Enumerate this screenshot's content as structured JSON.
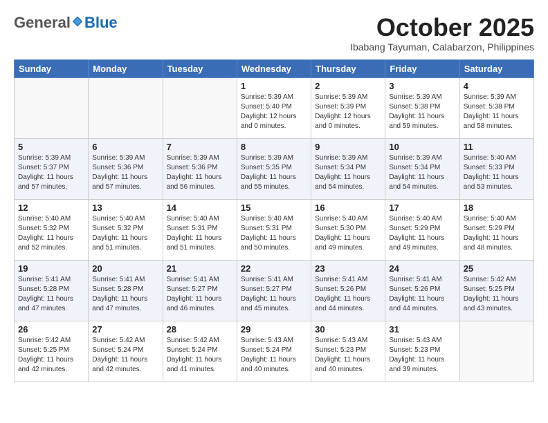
{
  "logo": {
    "general": "General",
    "blue": "Blue"
  },
  "title": "October 2025",
  "subtitle": "Ibabang Tayuman, Calabarzon, Philippines",
  "days_of_week": [
    "Sunday",
    "Monday",
    "Tuesday",
    "Wednesday",
    "Thursday",
    "Friday",
    "Saturday"
  ],
  "weeks": [
    [
      {
        "day": "",
        "info": ""
      },
      {
        "day": "",
        "info": ""
      },
      {
        "day": "",
        "info": ""
      },
      {
        "day": "1",
        "info": "Sunrise: 5:39 AM\nSunset: 5:40 PM\nDaylight: 12 hours\nand 0 minutes."
      },
      {
        "day": "2",
        "info": "Sunrise: 5:39 AM\nSunset: 5:39 PM\nDaylight: 12 hours\nand 0 minutes."
      },
      {
        "day": "3",
        "info": "Sunrise: 5:39 AM\nSunset: 5:38 PM\nDaylight: 11 hours\nand 59 minutes."
      },
      {
        "day": "4",
        "info": "Sunrise: 5:39 AM\nSunset: 5:38 PM\nDaylight: 11 hours\nand 58 minutes."
      }
    ],
    [
      {
        "day": "5",
        "info": "Sunrise: 5:39 AM\nSunset: 5:37 PM\nDaylight: 11 hours\nand 57 minutes."
      },
      {
        "day": "6",
        "info": "Sunrise: 5:39 AM\nSunset: 5:36 PM\nDaylight: 11 hours\nand 57 minutes."
      },
      {
        "day": "7",
        "info": "Sunrise: 5:39 AM\nSunset: 5:36 PM\nDaylight: 11 hours\nand 56 minutes."
      },
      {
        "day": "8",
        "info": "Sunrise: 5:39 AM\nSunset: 5:35 PM\nDaylight: 11 hours\nand 55 minutes."
      },
      {
        "day": "9",
        "info": "Sunrise: 5:39 AM\nSunset: 5:34 PM\nDaylight: 11 hours\nand 54 minutes."
      },
      {
        "day": "10",
        "info": "Sunrise: 5:39 AM\nSunset: 5:34 PM\nDaylight: 11 hours\nand 54 minutes."
      },
      {
        "day": "11",
        "info": "Sunrise: 5:40 AM\nSunset: 5:33 PM\nDaylight: 11 hours\nand 53 minutes."
      }
    ],
    [
      {
        "day": "12",
        "info": "Sunrise: 5:40 AM\nSunset: 5:32 PM\nDaylight: 11 hours\nand 52 minutes."
      },
      {
        "day": "13",
        "info": "Sunrise: 5:40 AM\nSunset: 5:32 PM\nDaylight: 11 hours\nand 51 minutes."
      },
      {
        "day": "14",
        "info": "Sunrise: 5:40 AM\nSunset: 5:31 PM\nDaylight: 11 hours\nand 51 minutes."
      },
      {
        "day": "15",
        "info": "Sunrise: 5:40 AM\nSunset: 5:31 PM\nDaylight: 11 hours\nand 50 minutes."
      },
      {
        "day": "16",
        "info": "Sunrise: 5:40 AM\nSunset: 5:30 PM\nDaylight: 11 hours\nand 49 minutes."
      },
      {
        "day": "17",
        "info": "Sunrise: 5:40 AM\nSunset: 5:29 PM\nDaylight: 11 hours\nand 49 minutes."
      },
      {
        "day": "18",
        "info": "Sunrise: 5:40 AM\nSunset: 5:29 PM\nDaylight: 11 hours\nand 48 minutes."
      }
    ],
    [
      {
        "day": "19",
        "info": "Sunrise: 5:41 AM\nSunset: 5:28 PM\nDaylight: 11 hours\nand 47 minutes."
      },
      {
        "day": "20",
        "info": "Sunrise: 5:41 AM\nSunset: 5:28 PM\nDaylight: 11 hours\nand 47 minutes."
      },
      {
        "day": "21",
        "info": "Sunrise: 5:41 AM\nSunset: 5:27 PM\nDaylight: 11 hours\nand 46 minutes."
      },
      {
        "day": "22",
        "info": "Sunrise: 5:41 AM\nSunset: 5:27 PM\nDaylight: 11 hours\nand 45 minutes."
      },
      {
        "day": "23",
        "info": "Sunrise: 5:41 AM\nSunset: 5:26 PM\nDaylight: 11 hours\nand 44 minutes."
      },
      {
        "day": "24",
        "info": "Sunrise: 5:41 AM\nSunset: 5:26 PM\nDaylight: 11 hours\nand 44 minutes."
      },
      {
        "day": "25",
        "info": "Sunrise: 5:42 AM\nSunset: 5:25 PM\nDaylight: 11 hours\nand 43 minutes."
      }
    ],
    [
      {
        "day": "26",
        "info": "Sunrise: 5:42 AM\nSunset: 5:25 PM\nDaylight: 11 hours\nand 42 minutes."
      },
      {
        "day": "27",
        "info": "Sunrise: 5:42 AM\nSunset: 5:24 PM\nDaylight: 11 hours\nand 42 minutes."
      },
      {
        "day": "28",
        "info": "Sunrise: 5:42 AM\nSunset: 5:24 PM\nDaylight: 11 hours\nand 41 minutes."
      },
      {
        "day": "29",
        "info": "Sunrise: 5:43 AM\nSunset: 5:24 PM\nDaylight: 11 hours\nand 40 minutes."
      },
      {
        "day": "30",
        "info": "Sunrise: 5:43 AM\nSunset: 5:23 PM\nDaylight: 11 hours\nand 40 minutes."
      },
      {
        "day": "31",
        "info": "Sunrise: 5:43 AM\nSunset: 5:23 PM\nDaylight: 11 hours\nand 39 minutes."
      },
      {
        "day": "",
        "info": ""
      }
    ]
  ]
}
